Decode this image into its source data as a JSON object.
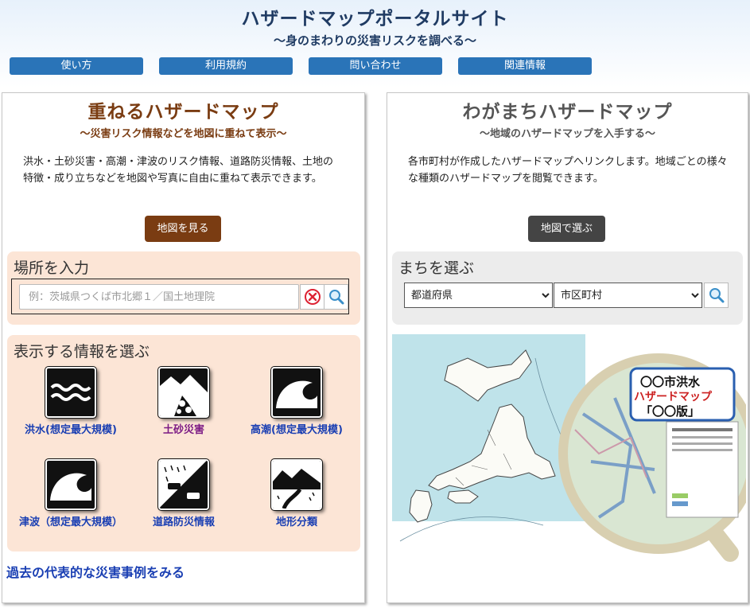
{
  "header": {
    "title": "ハザードマップポータルサイト",
    "subtitle": "～身のまわりの災害リスクを調べる～"
  },
  "nav": {
    "items": [
      "使い方",
      "利用規約",
      "問い合わせ",
      "関連情報"
    ]
  },
  "left": {
    "title": "重ねるハザードマップ",
    "subtitle": "～災害リスク情報などを地図に重ねて表示～",
    "description": "洪水・土砂災害・高潮・津波のリスク情報、道路防災情報、土地の特徴・成り立ちなどを地図や写真に自由に重ねて表示できます。",
    "button": "地図を見る",
    "search": {
      "title": "場所を入力",
      "placeholder": "例：茨城県つくば市北郷１／国土地理院"
    },
    "info": {
      "title": "表示する情報を選ぶ",
      "items": [
        {
          "label": "洪水(想定最大規模)",
          "icon": "flood-icon"
        },
        {
          "label": "土砂災害",
          "icon": "landslide-icon"
        },
        {
          "label": "高潮(想定最大規模)",
          "icon": "storm-surge-icon"
        },
        {
          "label": "津波（想定最大規模）",
          "icon": "tsunami-icon"
        },
        {
          "label": "道路防災情報",
          "icon": "road-disaster-icon"
        },
        {
          "label": "地形分類",
          "icon": "terrain-icon"
        }
      ]
    },
    "past_link": "過去の代表的な災害事例をみる"
  },
  "right": {
    "title": "わがまちハザードマップ",
    "subtitle": "～地域のハザードマップを入手する～",
    "description": "各市町村が作成したハザードマップへリンクします。地域ごとの様々な種類のハザードマップを閲覧できます。",
    "button": "地図で選ぶ",
    "select": {
      "title": "まちを選ぶ",
      "prefecture": "都道府県",
      "city": "市区町村"
    },
    "map_label": {
      "line1": "〇〇市洪水",
      "line2": "ハザードマップ",
      "line3": "「〇〇版」"
    }
  },
  "colors": {
    "nav": "#2a74b8",
    "left_accent": "#7a3c12",
    "right_accent": "#444444",
    "left_box": "#fce5d6",
    "right_box": "#ececec",
    "link": "#1a3fb3"
  }
}
